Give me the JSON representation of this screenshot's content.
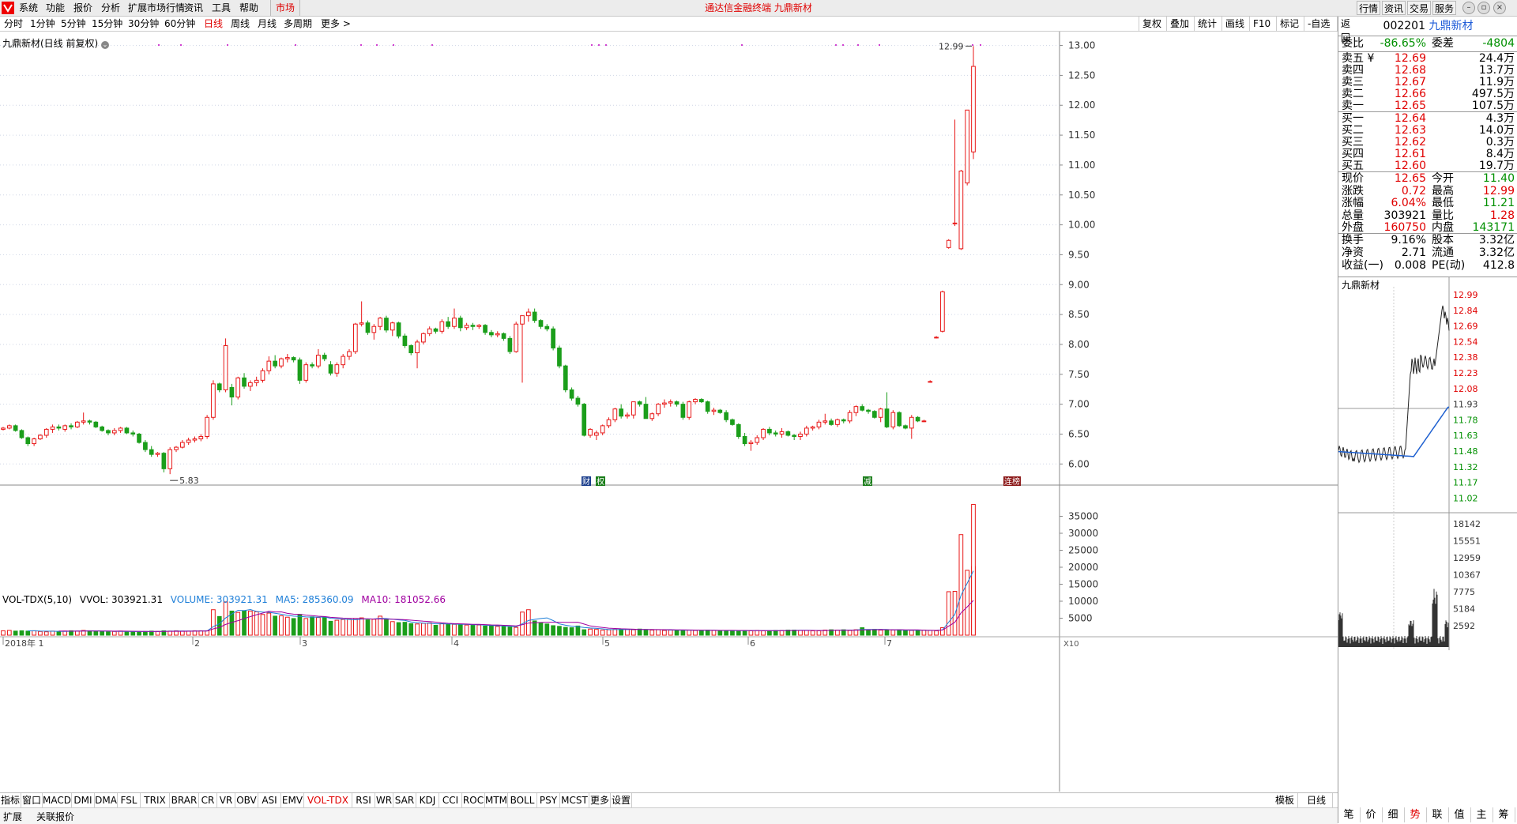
{
  "menu": {
    "items": [
      "系统",
      "功能",
      "报价",
      "分析",
      "扩展市场行情",
      "资讯",
      "工具",
      "帮助"
    ],
    "active_item": "市场",
    "title": "通达信金融终端 九鼎新材",
    "right_buttons": [
      "行情",
      "资讯",
      "交易",
      "服务"
    ]
  },
  "toolbar": {
    "timeframes": [
      "分时",
      "1分钟",
      "5分钟",
      "15分钟",
      "30分钟",
      "60分钟",
      "日线",
      "周线",
      "月线",
      "多周期",
      "更多 >"
    ],
    "active_timeframe": "日线",
    "right_tools": [
      "复权",
      "叠加",
      "统计",
      "画线",
      "F10",
      "标记",
      "-自选",
      "返回"
    ]
  },
  "chart": {
    "title": "九鼎新材(日线 前复权)",
    "max_label": "12.99",
    "min_label": "5.83",
    "event_markers": [
      "财",
      "权",
      "减",
      "连榜"
    ],
    "x_labels": [
      "2018年 1",
      "2",
      "3",
      "4",
      "5",
      "6",
      "7"
    ],
    "y_ticks": [
      "13.00",
      "12.50",
      "12.00",
      "11.50",
      "11.00",
      "10.50",
      "10.00",
      "9.50",
      "9.00",
      "8.50",
      "8.00",
      "7.50",
      "7.00",
      "6.50",
      "6.00"
    ],
    "vol_ticks": [
      "35000",
      "30000",
      "25000",
      "20000",
      "15000",
      "10000",
      "5000"
    ],
    "vol_unit": "X10"
  },
  "chart_data": {
    "type": "candlestick",
    "ylim": [
      5.7,
      13.1
    ],
    "candles": [
      [
        6.58,
        6.62,
        6.56,
        6.6
      ],
      [
        6.6,
        6.66,
        6.58,
        6.64
      ],
      [
        6.64,
        6.66,
        6.54,
        6.56
      ],
      [
        6.56,
        6.58,
        6.42,
        6.44
      ],
      [
        6.44,
        6.46,
        6.3,
        6.34
      ],
      [
        6.34,
        6.44,
        6.3,
        6.42
      ],
      [
        6.42,
        6.5,
        6.4,
        6.48
      ],
      [
        6.48,
        6.6,
        6.44,
        6.58
      ],
      [
        6.58,
        6.66,
        6.52,
        6.62
      ],
      [
        6.62,
        6.66,
        6.56,
        6.6
      ],
      [
        6.58,
        6.66,
        6.54,
        6.64
      ],
      [
        6.64,
        6.68,
        6.58,
        6.62
      ],
      [
        6.62,
        6.72,
        6.6,
        6.7
      ],
      [
        6.7,
        6.86,
        6.66,
        6.72
      ],
      [
        6.72,
        6.74,
        6.66,
        6.7
      ],
      [
        6.7,
        6.72,
        6.6,
        6.62
      ],
      [
        6.62,
        6.64,
        6.54,
        6.56
      ],
      [
        6.56,
        6.58,
        6.48,
        6.52
      ],
      [
        6.52,
        6.6,
        6.48,
        6.56
      ],
      [
        6.56,
        6.62,
        6.52,
        6.6
      ],
      [
        6.6,
        6.62,
        6.5,
        6.52
      ],
      [
        6.52,
        6.56,
        6.46,
        6.5
      ],
      [
        6.5,
        6.52,
        6.34,
        6.36
      ],
      [
        6.36,
        6.4,
        6.2,
        6.24
      ],
      [
        6.24,
        6.3,
        6.12,
        6.16
      ],
      [
        6.16,
        6.2,
        6.12,
        6.18
      ],
      [
        6.18,
        6.2,
        5.86,
        5.92
      ],
      [
        5.92,
        6.28,
        5.83,
        6.24
      ],
      [
        6.24,
        6.3,
        6.2,
        6.28
      ],
      [
        6.28,
        6.4,
        6.26,
        6.36
      ],
      [
        6.36,
        6.44,
        6.32,
        6.4
      ],
      [
        6.4,
        6.46,
        6.36,
        6.42
      ],
      [
        6.42,
        6.5,
        6.38,
        6.46
      ],
      [
        6.46,
        6.82,
        6.42,
        6.78
      ],
      [
        6.78,
        7.4,
        6.74,
        7.34
      ],
      [
        7.34,
        7.36,
        7.2,
        7.24
      ],
      [
        7.24,
        8.1,
        7.2,
        7.98
      ],
      [
        7.28,
        7.34,
        6.98,
        7.12
      ],
      [
        7.12,
        7.46,
        7.08,
        7.44
      ],
      [
        7.44,
        7.52,
        7.26,
        7.3
      ],
      [
        7.3,
        7.4,
        7.22,
        7.36
      ],
      [
        7.36,
        7.46,
        7.3,
        7.4
      ],
      [
        7.4,
        7.6,
        7.36,
        7.56
      ],
      [
        7.56,
        7.8,
        7.5,
        7.72
      ],
      [
        7.72,
        7.82,
        7.6,
        7.64
      ],
      [
        7.64,
        7.78,
        7.6,
        7.76
      ],
      [
        7.76,
        7.84,
        7.7,
        7.78
      ],
      [
        7.78,
        7.8,
        7.7,
        7.74
      ],
      [
        7.74,
        7.78,
        7.34,
        7.4
      ],
      [
        7.4,
        7.7,
        7.36,
        7.66
      ],
      [
        7.66,
        7.7,
        7.6,
        7.64
      ],
      [
        7.64,
        7.92,
        7.6,
        7.82
      ],
      [
        7.82,
        7.86,
        7.72,
        7.76
      ],
      [
        7.66,
        7.72,
        7.48,
        7.52
      ],
      [
        7.52,
        7.7,
        7.46,
        7.66
      ],
      [
        7.66,
        7.84,
        7.6,
        7.8
      ],
      [
        7.8,
        7.92,
        7.74,
        7.88
      ],
      [
        7.88,
        8.36,
        7.84,
        8.34
      ],
      [
        8.34,
        8.72,
        8.3,
        8.36
      ],
      [
        8.36,
        8.4,
        8.16,
        8.2
      ],
      [
        8.2,
        8.34,
        8.08,
        8.3
      ],
      [
        8.3,
        8.46,
        8.24,
        8.44
      ],
      [
        8.44,
        8.48,
        8.2,
        8.24
      ],
      [
        8.24,
        8.38,
        8.14,
        8.36
      ],
      [
        8.36,
        8.38,
        8.1,
        8.14
      ],
      [
        8.14,
        8.18,
        7.94,
        7.98
      ],
      [
        7.98,
        8.0,
        7.82,
        7.86
      ],
      [
        7.86,
        8.08,
        7.6,
        8.04
      ],
      [
        8.04,
        8.2,
        8.0,
        8.18
      ],
      [
        8.18,
        8.3,
        8.14,
        8.26
      ],
      [
        8.26,
        8.28,
        8.18,
        8.22
      ],
      [
        8.22,
        8.42,
        8.18,
        8.38
      ],
      [
        8.38,
        8.46,
        8.26,
        8.3
      ],
      [
        8.3,
        8.6,
        8.26,
        8.44
      ],
      [
        8.44,
        8.48,
        8.22,
        8.28
      ],
      [
        8.28,
        8.36,
        8.24,
        8.32
      ],
      [
        8.32,
        8.36,
        8.24,
        8.3
      ],
      [
        8.3,
        8.34,
        8.26,
        8.32
      ],
      [
        8.32,
        8.34,
        8.16,
        8.2
      ],
      [
        8.2,
        8.24,
        8.12,
        8.16
      ],
      [
        8.16,
        8.22,
        8.12,
        8.18
      ],
      [
        8.18,
        8.2,
        8.06,
        8.1
      ],
      [
        8.1,
        8.14,
        7.84,
        7.88
      ],
      [
        7.88,
        8.38,
        7.86,
        8.34
      ],
      [
        8.34,
        8.44,
        7.36,
        8.48
      ],
      [
        8.48,
        8.6,
        8.38,
        8.54
      ],
      [
        8.54,
        8.6,
        8.36,
        8.4
      ],
      [
        8.4,
        8.42,
        8.26,
        8.3
      ],
      [
        8.3,
        8.34,
        8.22,
        8.26
      ],
      [
        8.26,
        8.3,
        7.9,
        7.94
      ],
      [
        7.94,
        7.98,
        7.6,
        7.64
      ],
      [
        7.64,
        7.66,
        7.2,
        7.24
      ],
      [
        7.24,
        7.28,
        7.06,
        7.1
      ],
      [
        7.1,
        7.14,
        6.96,
        7.0
      ],
      [
        7.0,
        7.02,
        6.46,
        6.48
      ],
      [
        6.48,
        6.6,
        6.44,
        6.58
      ],
      [
        6.48,
        6.56,
        6.4,
        6.52
      ],
      [
        6.52,
        6.66,
        6.48,
        6.64
      ],
      [
        6.64,
        6.78,
        6.6,
        6.74
      ],
      [
        6.74,
        6.94,
        6.7,
        6.92
      ],
      [
        6.92,
        7.0,
        6.76,
        6.8
      ],
      [
        6.8,
        6.86,
        6.76,
        6.82
      ],
      [
        6.82,
        7.04,
        6.76,
        7.04
      ],
      [
        7.04,
        7.06,
        6.96,
        7.0
      ],
      [
        7.0,
        7.12,
        6.96,
        6.76
      ],
      [
        6.76,
        6.86,
        6.72,
        6.84
      ],
      [
        6.84,
        7.02,
        6.8,
        7.0
      ],
      [
        7.0,
        7.08,
        6.94,
        7.02
      ],
      [
        7.02,
        7.08,
        6.96,
        7.04
      ],
      [
        7.04,
        7.06,
        6.96,
        7.0
      ],
      [
        7.0,
        7.04,
        6.74,
        6.78
      ],
      [
        6.78,
        7.06,
        6.74,
        7.04
      ],
      [
        7.04,
        7.1,
        7.0,
        7.08
      ],
      [
        7.08,
        7.1,
        7.02,
        7.04
      ],
      [
        7.04,
        7.06,
        6.84,
        6.88
      ],
      [
        6.88,
        6.94,
        6.82,
        6.9
      ],
      [
        6.9,
        6.92,
        6.84,
        6.86
      ],
      [
        6.86,
        6.9,
        6.7,
        6.74
      ],
      [
        6.74,
        6.76,
        6.64,
        6.66
      ],
      [
        6.66,
        6.68,
        6.42,
        6.46
      ],
      [
        6.46,
        6.52,
        6.3,
        6.34
      ],
      [
        6.34,
        6.4,
        6.22,
        6.36
      ],
      [
        6.36,
        6.48,
        6.32,
        6.44
      ],
      [
        6.44,
        6.6,
        6.4,
        6.58
      ],
      [
        6.58,
        6.62,
        6.48,
        6.52
      ],
      [
        6.52,
        6.56,
        6.46,
        6.5
      ],
      [
        6.5,
        6.6,
        6.44,
        6.54
      ],
      [
        6.54,
        6.56,
        6.46,
        6.48
      ],
      [
        6.48,
        6.5,
        6.4,
        6.46
      ],
      [
        6.46,
        6.54,
        6.4,
        6.5
      ],
      [
        6.5,
        6.64,
        6.46,
        6.6
      ],
      [
        6.6,
        6.64,
        6.56,
        6.62
      ],
      [
        6.62,
        6.74,
        6.58,
        6.7
      ],
      [
        6.7,
        6.84,
        6.66,
        6.72
      ],
      [
        6.72,
        6.76,
        6.64,
        6.66
      ],
      [
        6.66,
        6.76,
        6.62,
        6.74
      ],
      [
        6.74,
        6.76,
        6.68,
        6.72
      ],
      [
        6.72,
        6.9,
        6.68,
        6.86
      ],
      [
        6.86,
        6.98,
        6.8,
        6.96
      ],
      [
        6.96,
        7.0,
        6.88,
        6.9
      ],
      [
        6.9,
        6.92,
        6.84,
        6.88
      ],
      [
        6.88,
        6.9,
        6.76,
        6.78
      ],
      [
        6.78,
        6.94,
        6.7,
        6.92
      ],
      [
        6.92,
        7.2,
        6.6,
        6.62
      ],
      [
        6.62,
        6.9,
        6.58,
        6.86
      ],
      [
        6.86,
        6.88,
        6.62,
        6.64
      ],
      [
        6.64,
        6.66,
        6.58,
        6.6
      ],
      [
        6.6,
        6.82,
        6.42,
        6.78
      ],
      [
        6.78,
        6.8,
        6.7,
        6.72
      ],
      [
        6.72,
        6.74,
        6.7,
        6.72
      ],
      [
        7.38,
        7.4,
        7.36,
        7.38
      ],
      [
        8.12,
        8.14,
        8.1,
        8.12
      ],
      [
        8.22,
        8.9,
        8.2,
        8.88
      ],
      [
        9.62,
        9.76,
        9.6,
        9.74
      ],
      [
        10.03,
        11.76,
        9.98,
        10.03
      ],
      [
        9.6,
        10.92,
        9.58,
        10.9
      ],
      [
        10.7,
        11.92,
        10.66,
        11.92
      ],
      [
        11.22,
        12.99,
        11.1,
        12.65
      ]
    ],
    "volume": [
      1300,
      1400,
      1200,
      1300,
      1200,
      1300,
      1100,
      1000,
      1200,
      1100,
      1200,
      1300,
      1200,
      1400,
      1300,
      1200,
      1100,
      1000,
      1100,
      1200,
      1100,
      1000,
      1000,
      1100,
      1200,
      1100,
      1300,
      1200,
      1300,
      1200,
      1200,
      1300,
      1300,
      1300,
      7500,
      5500,
      9800,
      7100,
      6700,
      7100,
      7100,
      6900,
      6100,
      6500,
      5600,
      5700,
      5300,
      4900,
      6100,
      4900,
      5400,
      5200,
      5300,
      4100,
      4400,
      4600,
      4700,
      4900,
      5100,
      4500,
      4700,
      5600,
      4600,
      4000,
      3700,
      3800,
      3400,
      3300,
      3500,
      3600,
      2900,
      3400,
      3200,
      3200,
      3200,
      3000,
      2900,
      3000,
      2700,
      2700,
      2600,
      2600,
      2400,
      2300,
      6800,
      7500,
      4200,
      3700,
      3300,
      2800,
      2600,
      2300,
      2200,
      2700,
      1600,
      1800,
      1700,
      1500,
      1600,
      1700,
      1800,
      1700,
      1600,
      1800,
      1600,
      1500,
      1600,
      1400,
      1500,
      1400,
      1500,
      1500,
      1400,
      1400,
      1500,
      1400,
      1300,
      1300,
      1400,
      1300,
      1400,
      1300,
      1400,
      1300,
      1300,
      1400,
      1400,
      1500,
      1500,
      1400,
      1400,
      1300,
      1300,
      1500,
      1600,
      1500,
      1600,
      1400,
      1600,
      2200,
      1600,
      1700,
      1500,
      1400,
      1500,
      1600,
      1300,
      1400,
      1400,
      1500,
      1400,
      1300,
      2200,
      12800,
      12900,
      29600,
      19100,
      20200
    ],
    "volume_extra": [
      38500
    ],
    "ma5_label": "285360.09",
    "ma10_label": "181052.66"
  },
  "vol_legend": {
    "name": "VOL-TDX(5,10)",
    "vvol": "VVOL: 303921.31",
    "volume": "VOLUME: 303921.31",
    "ma5": "MA5: 285360.09",
    "ma10": "MA10: 181052.66"
  },
  "indicators": [
    "指标",
    "窗口",
    "MACD",
    "DMI",
    "DMA",
    "FSL",
    "TRIX",
    "BRAR",
    "CR",
    "VR",
    "OBV",
    "ASI",
    "EMV",
    "VOL-TDX",
    "RSI",
    "WR",
    "SAR",
    "KDJ",
    "CCI",
    "ROC",
    "MTM",
    "BOLL",
    "PSY",
    "MCST",
    "更多",
    "设置"
  ],
  "active_indicator": "VOL-TDX",
  "template_btn": "模板",
  "period_btn": "日线",
  "status": [
    "扩展",
    "关联报价"
  ],
  "quote": {
    "code": "002201",
    "name": "九鼎新材",
    "weibi_label": "委比",
    "weibi": "-86.65%",
    "weicha_label": "委差",
    "weicha": "-4804",
    "asks": [
      {
        "label": "卖五 ¥",
        "price": "12.69",
        "vol": "24.4万"
      },
      {
        "label": "卖四",
        "price": "12.68",
        "vol": "13.7万"
      },
      {
        "label": "卖三",
        "price": "12.67",
        "vol": "11.9万"
      },
      {
        "label": "卖二",
        "price": "12.66",
        "vol": "497.5万"
      },
      {
        "label": "卖一",
        "price": "12.65",
        "vol": "107.5万"
      }
    ],
    "bids": [
      {
        "label": "买一",
        "price": "12.64",
        "vol": "4.3万"
      },
      {
        "label": "买二",
        "price": "12.63",
        "vol": "14.0万"
      },
      {
        "label": "买三",
        "price": "12.62",
        "vol": "0.3万"
      },
      {
        "label": "买四",
        "price": "12.61",
        "vol": "8.4万"
      },
      {
        "label": "买五",
        "price": "12.60",
        "vol": "19.7万"
      }
    ],
    "stats": [
      {
        "k": "现价",
        "v": "12.65",
        "vc": "red",
        "k2": "今开",
        "v2": "11.40",
        "v2c": "green"
      },
      {
        "k": "涨跌",
        "v": "0.72",
        "vc": "red",
        "k2": "最高",
        "v2": "12.99",
        "v2c": "red"
      },
      {
        "k": "涨幅",
        "v": "6.04%",
        "vc": "red",
        "k2": "最低",
        "v2": "11.21",
        "v2c": "green"
      },
      {
        "k": "总量",
        "v": "303921",
        "vc": "blk",
        "k2": "量比",
        "v2": "1.28",
        "v2c": "red"
      },
      {
        "k": "外盘",
        "v": "160750",
        "vc": "red",
        "k2": "内盘",
        "v2": "143171",
        "v2c": "green"
      }
    ],
    "stats2": [
      {
        "k": "换手",
        "v": "9.16%",
        "k2": "股本",
        "v2": "3.32亿"
      },
      {
        "k": "净资",
        "v": "2.71",
        "k2": "流通",
        "v2": "3.32亿"
      },
      {
        "k": "收益(一)",
        "v": "0.008",
        "k2": "PE(动)",
        "v2": "412.8"
      }
    ],
    "mini_title": "九鼎新材",
    "mini_y": [
      "12.99",
      "12.84",
      "12.69",
      "12.54",
      "12.38",
      "12.23",
      "12.08",
      "11.93",
      "11.78",
      "11.63",
      "11.48",
      "11.32",
      "11.17",
      "11.02"
    ],
    "mini_vol": [
      "18142",
      "15551",
      "12959",
      "10367",
      "7775",
      "5184",
      "2592"
    ],
    "bottom_tabs": [
      "笔",
      "价",
      "细",
      "势",
      "联",
      "值",
      "主",
      "筹"
    ],
    "active_tab": "势"
  }
}
